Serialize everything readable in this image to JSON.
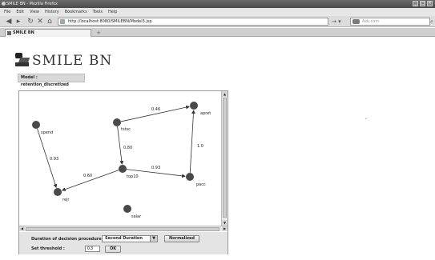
{
  "browser": {
    "window_title": "SMILE BN - Mozilla Firefox",
    "menu": [
      "File",
      "Edit",
      "View",
      "History",
      "Bookmarks",
      "Tools",
      "Help"
    ],
    "url": "http://localhost:8080/SMILEBN/Model3.jsp",
    "search_placeholder": "Ask.com",
    "tab_title": "SMILE BN",
    "new_tab_label": "+"
  },
  "page": {
    "app_title": "SMILE BN",
    "model_label": "Model : retention_discretized"
  },
  "network": {
    "nodes": [
      {
        "id": "spend",
        "label": "spend"
      },
      {
        "id": "tstsc",
        "label": "tstsc"
      },
      {
        "id": "apret",
        "label": "apret"
      },
      {
        "id": "top10",
        "label": "top10"
      },
      {
        "id": "pacc",
        "label": "pacc"
      },
      {
        "id": "rejr",
        "label": "rejr"
      },
      {
        "id": "salar",
        "label": "salar"
      }
    ],
    "edges": [
      {
        "from": "tstsc",
        "to": "apret",
        "weight": "0.46"
      },
      {
        "from": "spend",
        "to": "rejr",
        "weight": "0.93"
      },
      {
        "from": "tstsc",
        "to": "top10",
        "weight": "0.80"
      },
      {
        "from": "pacc",
        "to": "apret",
        "weight": "1.0"
      },
      {
        "from": "top10",
        "to": "pacc",
        "weight": "0.93"
      },
      {
        "from": "top10",
        "to": "rejr",
        "weight": "0.60"
      }
    ]
  },
  "controls": {
    "duration_label": "Duration of decision procedure :",
    "duration_value": "Second Duration",
    "normalized_button": "Normalized",
    "threshold_label": "Set threshold :",
    "threshold_value": "0.3",
    "ok_button": "OK"
  },
  "colors": {
    "node_fill": "#4a4a4a",
    "edge": "#333333",
    "panel_bg": "#e4e4e4"
  }
}
